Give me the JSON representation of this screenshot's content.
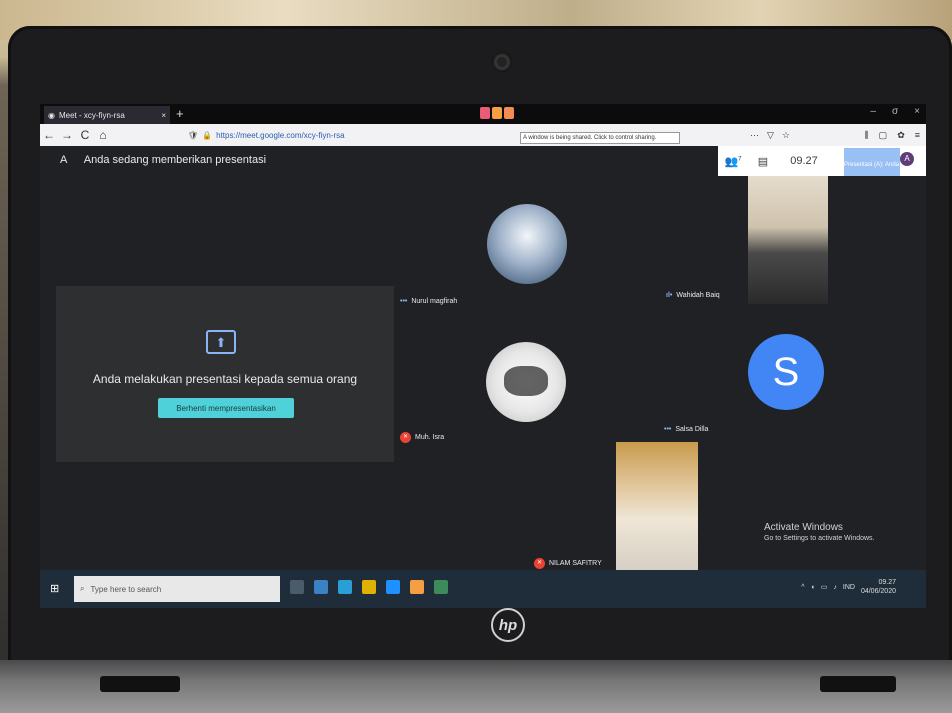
{
  "browser": {
    "tab_title": "Meet - xcy-fiyn-rsa",
    "tab_close": "×",
    "new_tab": "+",
    "url": "https://meet.google.com/xcy-fiyn-rsa",
    "share_tooltip": "A window is being shared. Click to control sharing.",
    "nav": {
      "back": "←",
      "forward": "→",
      "reload": "C",
      "home": "⌂"
    },
    "window_controls": {
      "minimize": "–",
      "maximize": "σ",
      "close": "×"
    }
  },
  "meet": {
    "presenting_initial": "A",
    "presenting_notice": "Anda sedang memberikan presentasi",
    "participants_icon_badge": "7",
    "time": "09.27",
    "presenter_label": "Presentasi (A): Anda",
    "self_avatar": "A",
    "presentation_message": "Anda melakukan presentasi kepada semua orang",
    "stop_button": "Berhenti mempresentasikan",
    "participants": [
      {
        "name": "Nurul magfirah",
        "state": "speaking"
      },
      {
        "name": "Wahidah Baiq",
        "state": "speaking"
      },
      {
        "name": "Muh. Isra",
        "state": "muted"
      },
      {
        "name": "Salsa Dilla",
        "state": "speaking",
        "avatar_letter": "S"
      },
      {
        "name": "NILAM SAFITRY",
        "state": "muted"
      }
    ],
    "activate_windows": {
      "title": "Activate Windows",
      "subtitle": "Go to Settings to activate Windows."
    }
  },
  "taskbar": {
    "search_placeholder": "Type here to search",
    "tray_lang": "IND",
    "time": "09.27",
    "date": "04/06/2020"
  },
  "laptop": {
    "brand": "hp"
  },
  "colors": {
    "meet_bg": "#202124",
    "accent": "#4fd1d9",
    "avatar_blue": "#4285f4",
    "mute_red": "#ea4335"
  }
}
